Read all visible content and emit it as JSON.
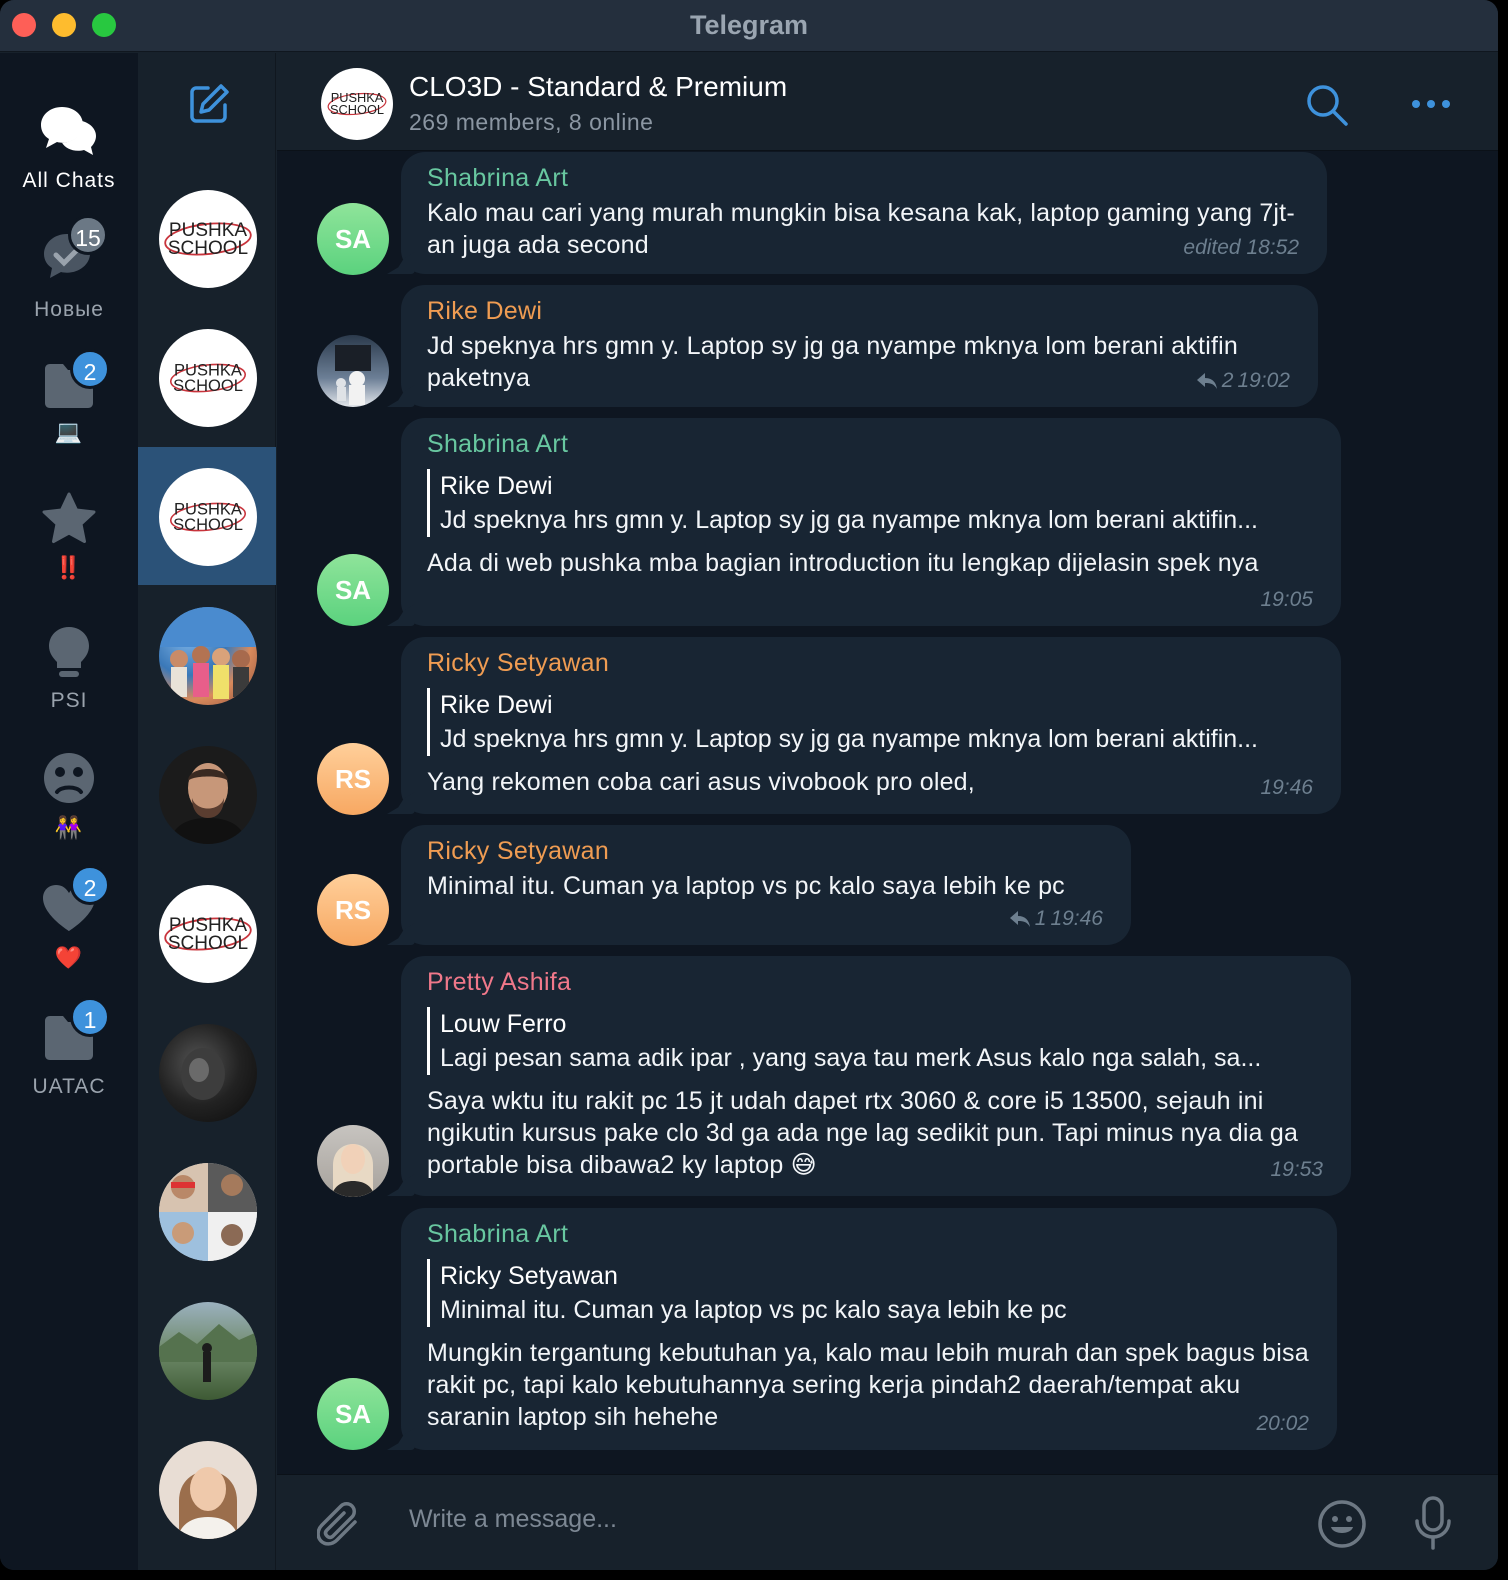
{
  "window": {
    "title": "Telegram"
  },
  "folders": [
    {
      "label": "All Chats",
      "icon": "chats-icon",
      "badge": ""
    },
    {
      "label": "Новые",
      "icon": "chat-check-icon",
      "badge": "15"
    },
    {
      "label": "💻",
      "icon": "folder-icon",
      "badge": "2"
    },
    {
      "label": "‼️",
      "icon": "star-icon",
      "badge": ""
    },
    {
      "label": "PSI",
      "icon": "lightbulb-icon",
      "badge": ""
    },
    {
      "label": "👭",
      "icon": "sad-face-icon",
      "badge": ""
    },
    {
      "label": "❤️",
      "icon": "heart-icon",
      "badge": "2"
    },
    {
      "label": "UATAC",
      "icon": "folder-icon",
      "badge": "1"
    }
  ],
  "chat": {
    "title": "CLO3D - Standard & Premium",
    "subtitle": "269 members, 8 online"
  },
  "logo_text": {
    "line1": "PUSHKA",
    "line2": "SCHOOL"
  },
  "messages": [
    {
      "sender": "Shabrina Art",
      "avatar_initials": "SA",
      "reply_name": "",
      "reply_text": "",
      "text": "Kalo mau cari yang murah mungkin bisa kesana kak, laptop gaming yang 7jt-an juga ada second",
      "meta": "edited 18:52",
      "reply_count": ""
    },
    {
      "sender": "Rike Dewi",
      "avatar_initials": "",
      "reply_name": "",
      "reply_text": "",
      "text": "Jd speknya hrs gmn y. Laptop sy jg ga nyampe mknya lom berani aktifin paketnya",
      "meta": "19:02",
      "reply_count": "2"
    },
    {
      "sender": "Shabrina Art",
      "avatar_initials": "SA",
      "reply_name": "Rike Dewi",
      "reply_text": "Jd speknya hrs gmn y. Laptop sy jg ga nyampe mknya lom berani aktifin...",
      "text": "Ada di web pushka mba bagian introduction itu lengkap dijelasin spek nya",
      "meta": "19:05",
      "reply_count": ""
    },
    {
      "sender": "Ricky Setyawan",
      "avatar_initials": "RS",
      "reply_name": "Rike Dewi",
      "reply_text": "Jd speknya hrs gmn y. Laptop sy jg ga nyampe mknya lom berani aktifin...",
      "text": "Yang rekomen coba cari asus vivobook pro oled,",
      "meta": "19:46",
      "reply_count": ""
    },
    {
      "sender": "Ricky Setyawan",
      "avatar_initials": "RS",
      "reply_name": "",
      "reply_text": "",
      "text": "Minimal itu. Cuman ya laptop vs pc kalo saya lebih ke pc",
      "meta": "19:46",
      "reply_count": "1"
    },
    {
      "sender": "Pretty Ashifa",
      "avatar_initials": "",
      "reply_name": "Louw Ferro",
      "reply_text": "Lagi pesan sama adik ipar , yang saya tau merk Asus kalo nga salah, sa...",
      "text": "Saya wktu itu rakit pc 15 jt udah dapet rtx 3060 & core i5 13500, sejauh ini ngikutin kursus pake clo 3d ga ada nge lag sedikit pun. Tapi minus nya dia ga portable bisa dibawa2 ky laptop 😅",
      "meta": "19:53",
      "reply_count": ""
    },
    {
      "sender": "Shabrina Art",
      "avatar_initials": "SA",
      "reply_name": "Ricky Setyawan",
      "reply_text": "Minimal itu. Cuman ya laptop vs pc kalo saya lebih ke pc",
      "text": "Mungkin tergantung kebutuhan ya, kalo mau lebih murah dan spek bagus bisa rakit pc, tapi kalo kebutuhannya sering kerja pindah2 daerah/tempat aku saranin laptop sih hehehe",
      "meta": "20:02",
      "reply_count": ""
    }
  ],
  "composer": {
    "placeholder": "Write a message..."
  },
  "colors": {
    "sender_green": "#68c7a0",
    "sender_orange": "#ef9c52",
    "sender_pink": "#f0788a",
    "accent": "#3e92dc",
    "selected_chat": "#2b5278"
  }
}
